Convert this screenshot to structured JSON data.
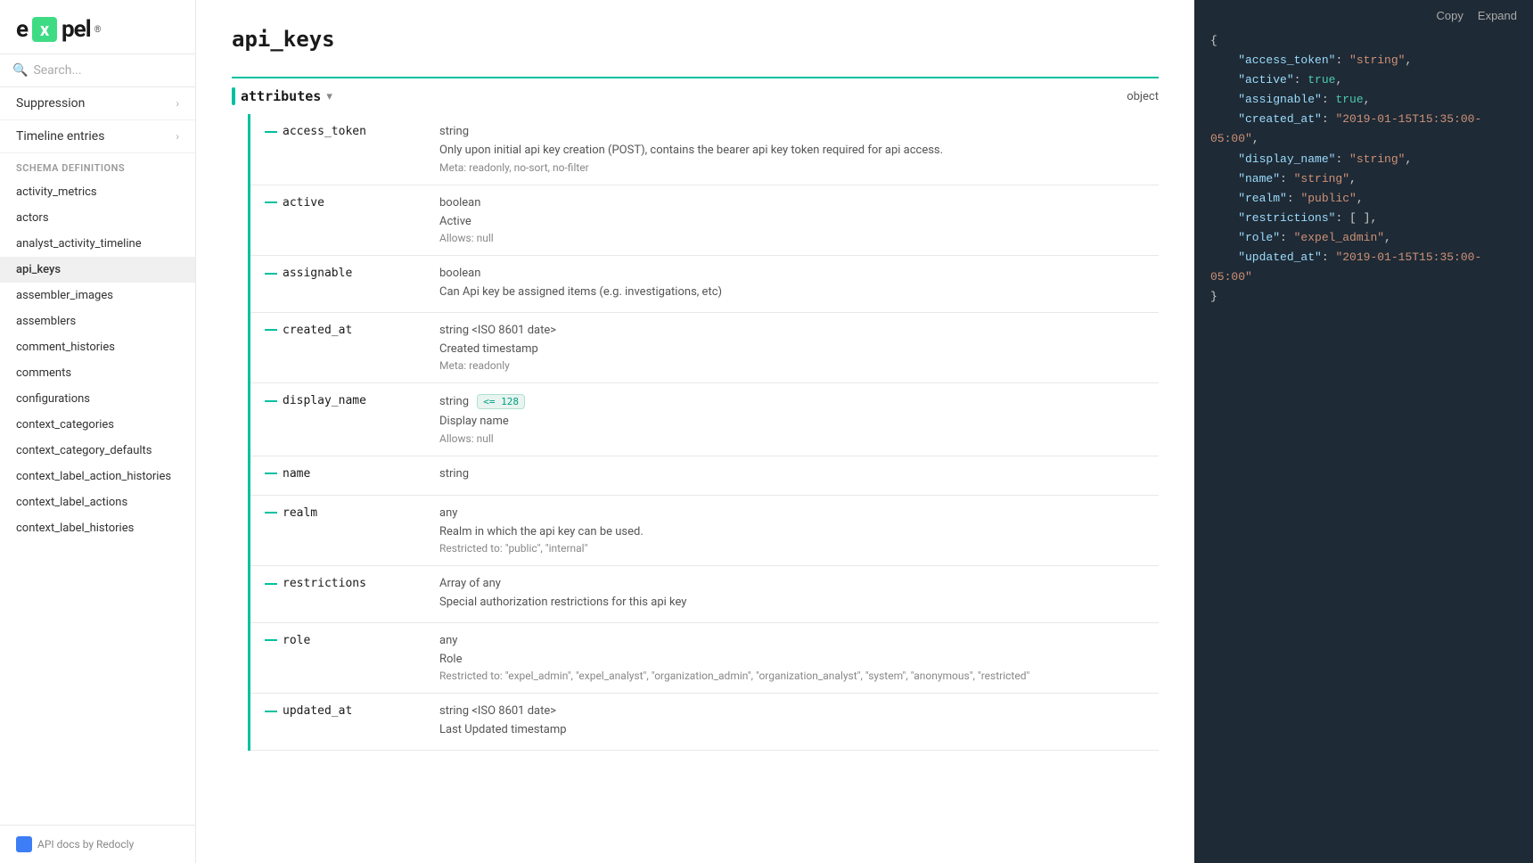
{
  "logo": {
    "prefix": "e",
    "x": "x",
    "suffix": "pel",
    "tm": "®"
  },
  "search": {
    "placeholder": "Search..."
  },
  "nav": {
    "items": [
      {
        "label": "Suppression",
        "hasChevron": true
      },
      {
        "label": "Timeline entries",
        "hasChevron": true
      }
    ]
  },
  "schema": {
    "section_label": "SCHEMA DEFINITIONS",
    "items": [
      "activity_metrics",
      "actors",
      "analyst_activity_timeline",
      "api_keys",
      "assembler_images",
      "assemblers",
      "comment_histories",
      "comments",
      "configurations",
      "context_categories",
      "context_category_defaults",
      "context_label_action_histories",
      "context_label_actions",
      "context_label_histories"
    ],
    "active": "api_keys"
  },
  "footer": {
    "label": "API docs by Redocly"
  },
  "page": {
    "title": "api_keys"
  },
  "attributes": {
    "label": "attributes",
    "toggle": "▾",
    "type": "object"
  },
  "fields": [
    {
      "name": "access_token",
      "type": "string",
      "desc": "Only upon initial api key creation (POST), contains the bearer api key token required for api access.",
      "meta": "Meta: readonly, no-sort, no-filter"
    },
    {
      "name": "active",
      "type": "boolean",
      "desc": "Active",
      "meta": "Allows: null"
    },
    {
      "name": "assignable",
      "type": "boolean",
      "desc": "Can Api key be assigned items (e.g. investigations, etc)"
    },
    {
      "name": "created_at",
      "type": "string <ISO 8601 date>",
      "desc": "Created timestamp",
      "meta": "Meta: readonly"
    },
    {
      "name": "display_name",
      "type": "string",
      "badge": "<= 128",
      "desc": "Display name",
      "meta": "Allows: null"
    },
    {
      "name": "name",
      "type": "string"
    },
    {
      "name": "realm",
      "type": "any",
      "desc": "Realm in which the api key can be used.",
      "meta": "Restricted to: \"public\", \"internal\""
    },
    {
      "name": "restrictions",
      "type": "Array of any",
      "desc": "Special authorization restrictions for this api key"
    },
    {
      "name": "role",
      "type": "any",
      "desc": "Role",
      "meta": "Restricted to: \"expel_admin\", \"expel_analyst\", \"organization_admin\", \"organization_analyst\", \"system\", \"anonymous\", \"restricted\""
    },
    {
      "name": "updated_at",
      "type": "string <ISO 8601 date>",
      "desc": "Last Updated timestamp"
    }
  ],
  "json_preview": {
    "copy_label": "Copy",
    "expand_label": "Expand",
    "lines": [
      {
        "text": "{",
        "type": "brace"
      },
      {
        "key": "access_token",
        "value": "\"string\"",
        "valueType": "string"
      },
      {
        "key": "active",
        "value": "true",
        "valueType": "bool-true"
      },
      {
        "key": "assignable",
        "value": "true",
        "valueType": "bool-true"
      },
      {
        "key": "created_at",
        "value": "\"2019-01-15T15:35:00-05:00\"",
        "valueType": "string"
      },
      {
        "key": "display_name",
        "value": "\"string\"",
        "valueType": "string"
      },
      {
        "key": "name",
        "value": "\"string\"",
        "valueType": "string"
      },
      {
        "key": "realm",
        "value": "\"public\"",
        "valueType": "string"
      },
      {
        "key": "restrictions",
        "value": "[ ],",
        "valueType": "bracket"
      },
      {
        "key": "role",
        "value": "\"expel_admin\"",
        "valueType": "string"
      },
      {
        "key": "updated_at",
        "value": "\"2019-01-15T15:35:00-05:00\"",
        "valueType": "string",
        "last": true
      },
      {
        "text": "}",
        "type": "brace"
      }
    ]
  }
}
